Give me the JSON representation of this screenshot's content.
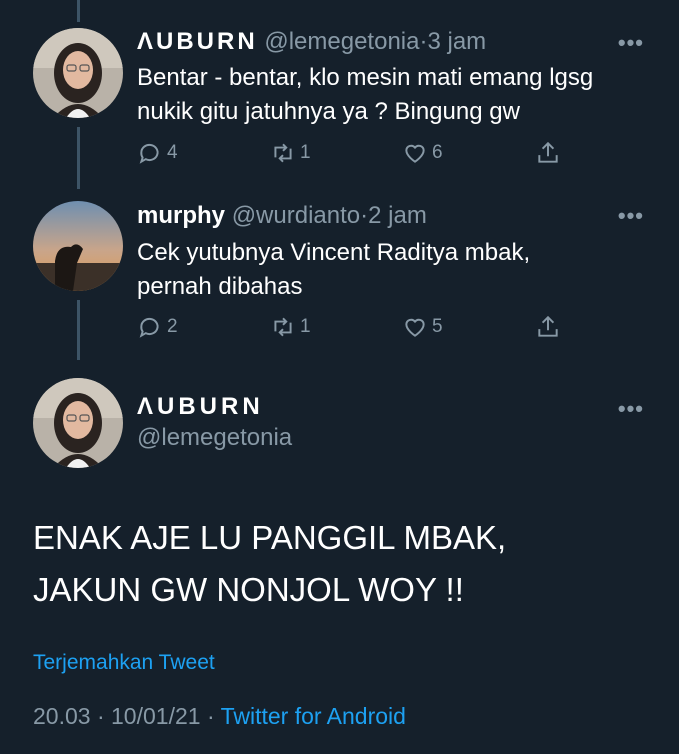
{
  "tweets": [
    {
      "name": "ΛUBURN",
      "handle": "@lemegetonia",
      "time": "3 jam",
      "text_lines": [
        "Bentar - bentar, klo mesin mati emang lgsg",
        "nukik gitu jatuhnya ya ? Bingung gw"
      ],
      "replies": "4",
      "retweets": "1",
      "likes": "6"
    },
    {
      "name": "murphy",
      "handle": "@wurdianto",
      "time": "2 jam",
      "text_lines": [
        "Cek yutubnya Vincent Raditya mbak,",
        "pernah dibahas"
      ],
      "replies": "2",
      "retweets": "1",
      "likes": "5"
    }
  ],
  "main": {
    "name": "ΛUBURN",
    "handle": "@lemegetonia",
    "text_lines": [
      "ENAK AJE LU PANGGIL MBAK,",
      "JAKUN GW NONJOL WOY !!"
    ],
    "translate": "Terjemahkan Tweet",
    "time": "20.03",
    "date": "10/01/21",
    "source": "Twitter for Android"
  },
  "ui": {
    "dot": "·",
    "more": "•••"
  },
  "colors": {
    "bg": "#15202b",
    "muted": "#8899a6",
    "accent": "#1da1f2",
    "thread": "#3d5466"
  },
  "icons": [
    "reply-icon",
    "retweet-icon",
    "like-icon",
    "share-icon",
    "more-icon"
  ]
}
